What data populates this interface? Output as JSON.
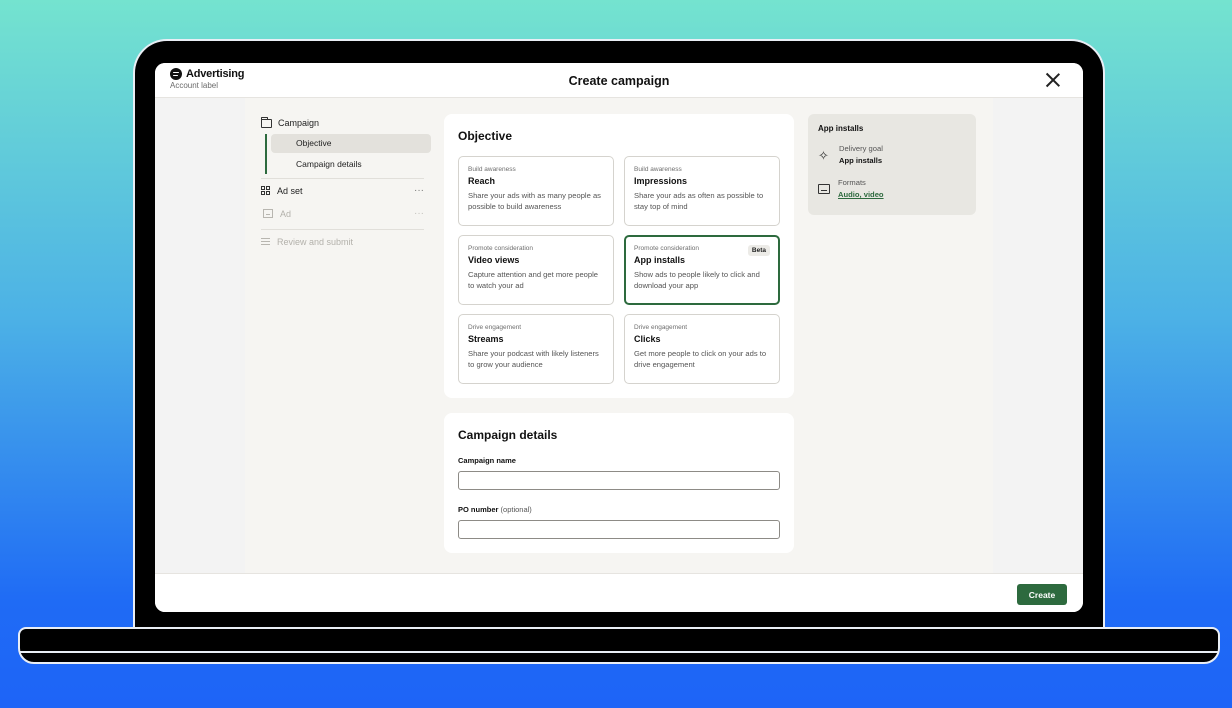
{
  "app": {
    "brand_name": "Advertising",
    "account_label": "Account label",
    "page_title": "Create campaign"
  },
  "nav": {
    "campaign": "Campaign",
    "sub_items": [
      "Objective",
      "Campaign details"
    ],
    "ad_set": "Ad set",
    "ad": "Ad",
    "review": "Review and submit",
    "more": "···"
  },
  "objective": {
    "title": "Objective",
    "cards": [
      {
        "kicker": "Build awareness",
        "title": "Reach",
        "desc": "Share your ads with as many people as possible to build awareness"
      },
      {
        "kicker": "Build awareness",
        "title": "Impressions",
        "desc": "Share your ads as often as possible to stay top of mind"
      },
      {
        "kicker": "Promote consideration",
        "title": "Video views",
        "desc": "Capture attention and get more people to watch your ad"
      },
      {
        "kicker": "Promote consideration",
        "title": "App installs",
        "desc": "Show ads to people likely to click and download your app",
        "badge": "Beta",
        "selected": true
      },
      {
        "kicker": "Drive engagement",
        "title": "Streams",
        "desc": "Share your podcast with likely listeners to grow your audience"
      },
      {
        "kicker": "Drive engagement",
        "title": "Clicks",
        "desc": "Get more people to click on your ads to drive engagement"
      }
    ]
  },
  "details": {
    "title": "Campaign details",
    "campaign_name_label": "Campaign name",
    "campaign_name_value": "",
    "po_label": "PO number",
    "po_optional": "(optional)",
    "po_value": ""
  },
  "summary": {
    "title": "App installs",
    "delivery_goal_label": "Delivery goal",
    "delivery_goal_value": "App installs",
    "formats_label": "Formats",
    "formats_value": "Audio, video"
  },
  "footer": {
    "create_label": "Create"
  },
  "colors": {
    "accent": "#2d6a3e",
    "selected_nav_bg": "#e3e1dc",
    "body_bg": "#f6f5f2"
  },
  "icons": [
    "spotify-logo-icon",
    "close-icon",
    "folder-icon",
    "grid-icon",
    "ad-icon",
    "list-icon",
    "sparkle-icon",
    "format-icon",
    "more-icon"
  ]
}
